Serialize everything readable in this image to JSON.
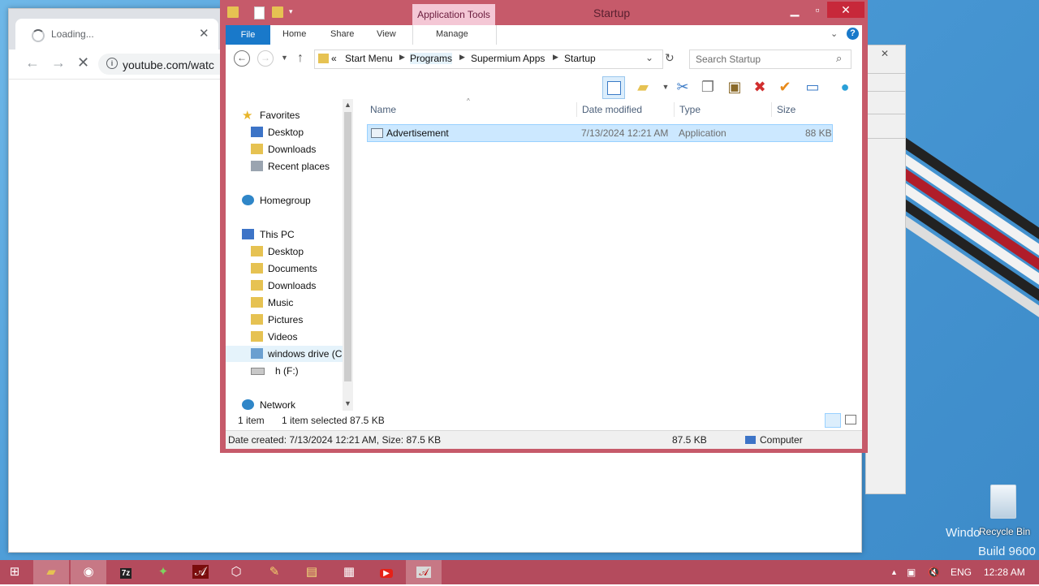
{
  "browser": {
    "tab_title": "Loading...",
    "url": "youtube.com/watc"
  },
  "explorer": {
    "context_tab": "Application Tools",
    "window_title": "Startup",
    "ribbon_tabs": [
      "File",
      "Home",
      "Share",
      "View",
      "Manage"
    ],
    "breadcrumbs": [
      "Start Menu",
      "Programs",
      "Supermium Apps",
      "Startup"
    ],
    "breadcrumb_overflow": "«",
    "search_placeholder": "Search Startup",
    "nav": {
      "favorites": "Favorites",
      "favorites_items": [
        "Desktop",
        "Downloads",
        "Recent places"
      ],
      "homegroup": "Homegroup",
      "thispc": "This PC",
      "thispc_items": [
        "Desktop",
        "Documents",
        "Downloads",
        "Music",
        "Pictures",
        "Videos",
        "windows drive (C",
        "h (F:)"
      ],
      "network": "Network"
    },
    "columns": [
      "Name",
      "Date modified",
      "Type",
      "Size"
    ],
    "files": [
      {
        "name": "Advertisement",
        "date": "7/13/2024 12:21 AM",
        "type": "Application",
        "size": "88 KB"
      }
    ],
    "status": {
      "count": "1 item",
      "selected": "1 item selected",
      "selected_size": "87.5 KB",
      "details": "Date created: 7/13/2024 12:21 AM, Size: 87.5 KB",
      "size2": "87.5 KB",
      "location": "Computer"
    }
  },
  "desktop": {
    "recycle_bin": "Recycle Bin",
    "watermark_line1": "Windo",
    "watermark_line2": "Build 9600"
  },
  "taskbar": {
    "lang": "ENG",
    "clock": "12:28 AM"
  },
  "colors": {
    "accent": "#b44b5d",
    "explorer_frame": "#c65a6a",
    "file_tab": "#1979ca",
    "selection": "#cce8ff"
  }
}
